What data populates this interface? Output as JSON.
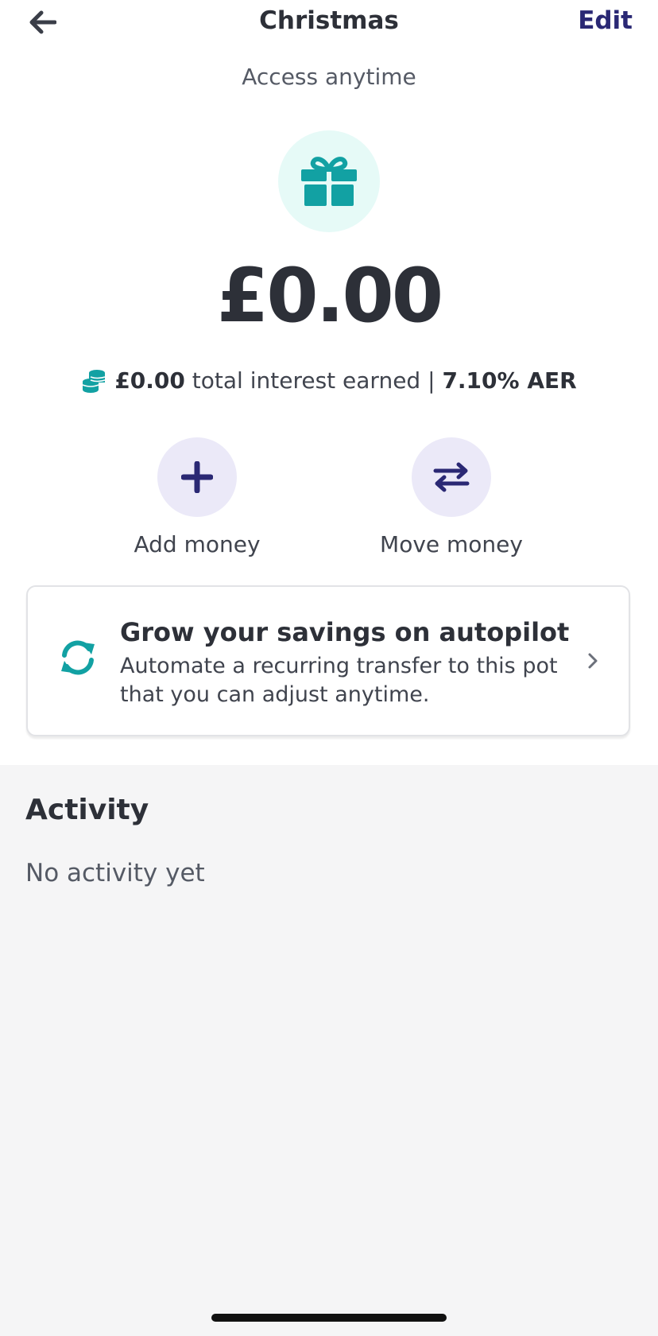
{
  "header": {
    "title": "Christmas",
    "edit_label": "Edit",
    "back_icon": "arrow-left-icon"
  },
  "pot": {
    "access": "Access anytime",
    "icon": "gift-icon",
    "balance": "£0.00",
    "interest_amount": "£0.00",
    "interest_text": "total interest earned |",
    "aer": "7.10% AER"
  },
  "actions": [
    {
      "label": "Add money",
      "icon": "plus-icon"
    },
    {
      "label": "Move money",
      "icon": "transfer-arrows-icon"
    }
  ],
  "autopilot_card": {
    "title": "Grow your savings on autopilot",
    "body": "Automate a recurring transfer to this pot that you can adjust anytime.",
    "icon": "refresh-icon"
  },
  "activity": {
    "title": "Activity",
    "empty_text": "No activity yet"
  },
  "colors": {
    "accent_teal": "#12a1a3",
    "accent_navy": "#2a2874",
    "action_bg": "#ebe9f8",
    "gift_bg": "#e6faf7"
  }
}
